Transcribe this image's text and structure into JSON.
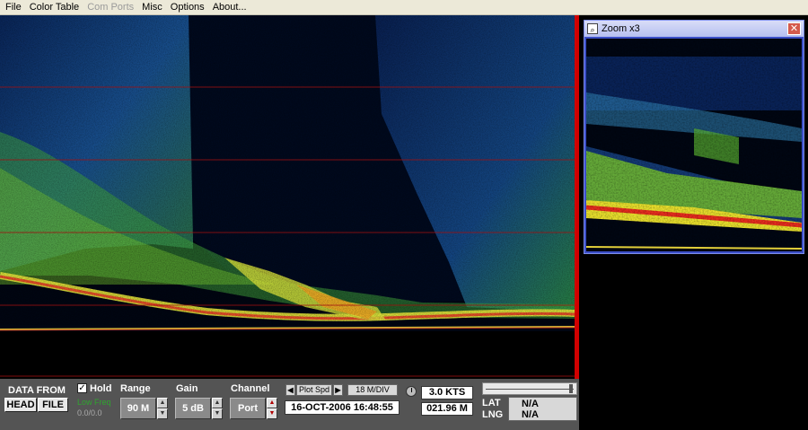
{
  "menu": {
    "items": [
      {
        "label": "File",
        "enabled": true
      },
      {
        "label": "Color Table",
        "enabled": true
      },
      {
        "label": "Com Ports",
        "enabled": false
      },
      {
        "label": "Misc",
        "enabled": true
      },
      {
        "label": "Options",
        "enabled": true
      },
      {
        "label": "About...",
        "enabled": true
      }
    ]
  },
  "zoom": {
    "title": "Zoom x3",
    "close_glyph": "✕"
  },
  "controls": {
    "data_from_label": "DATA FROM",
    "head_button": "HEAD",
    "file_button": "FILE",
    "hold_label": "Hold",
    "hold_checked": true,
    "low_freq_label": "Low Freq",
    "low_freq_value": "0.0/0.0",
    "range_label": "Range",
    "range_value": "90 M",
    "gain_label": "Gain",
    "gain_value": "5 dB",
    "channel_label": "Channel",
    "channel_value": "Port",
    "plot_speed_label": "Plot Spd",
    "scale_value": "18 M/DIV",
    "datetime": "16-OCT-2006  16:48:55",
    "speed_value": "3.0 KTS",
    "distance_value": "021.96 M",
    "lat_label": "LAT",
    "lng_label": "LNG",
    "lat_value": "N/A",
    "lng_value": "N/A"
  },
  "colors": {
    "menu_bg": "#ece9d8",
    "panel_bg": "#545454",
    "divider": "#d00000",
    "zoom_frame": "#3c4fc8",
    "low_freq": "#2fa52f"
  }
}
